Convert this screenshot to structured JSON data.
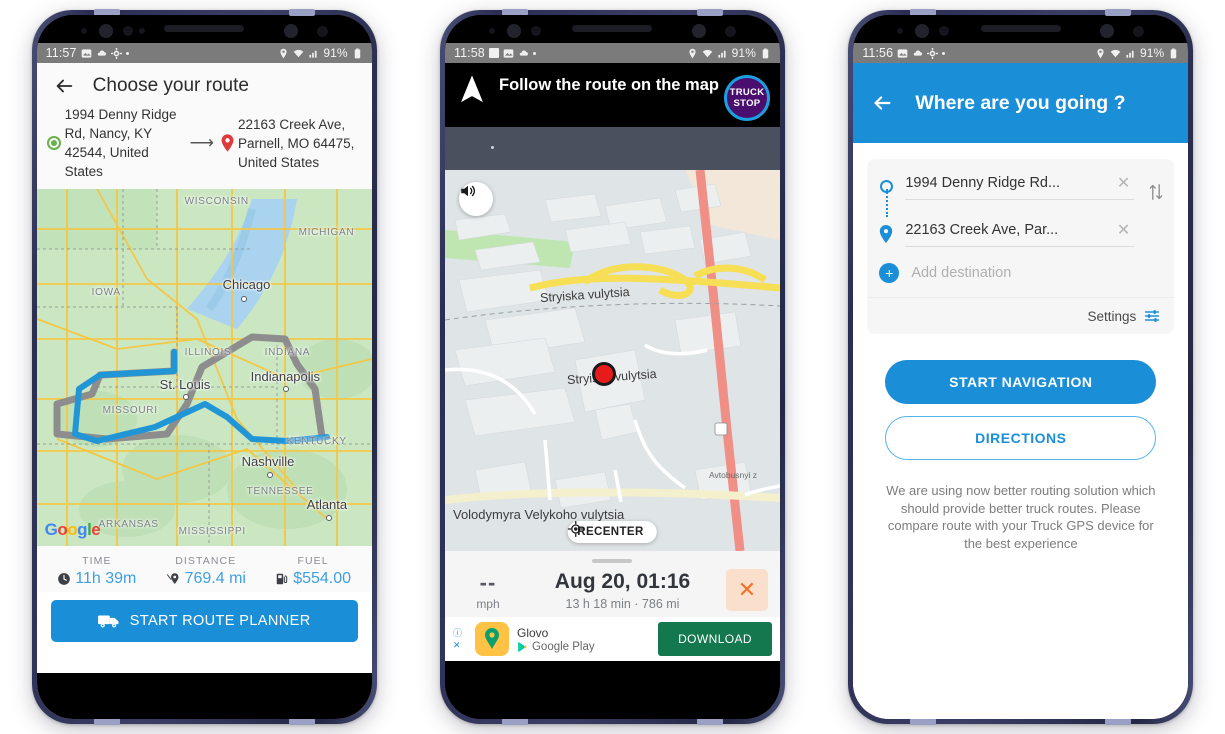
{
  "phones": [
    {
      "id": "choose-route",
      "status": {
        "time": "11:57",
        "battery": "91%",
        "icons": [
          "image-icon",
          "cloud-icon",
          "gear-icon",
          "dot-icon"
        ],
        "right_icons": [
          "location-pin-icon",
          "wifi-icon",
          "signal-icon",
          "battery-icon"
        ]
      },
      "header": {
        "title": "Choose your route",
        "back_icon": "back-arrow-icon"
      },
      "origin": "1994 Denny Ridge Rd, Nancy, KY 42544, United States",
      "destination": "22163 Creek Ave, Parnell, MO 64475, United States",
      "map": {
        "attribution": "Google",
        "state_labels": [
          "WISCONSIN",
          "MICHIGAN",
          "IOWA",
          "ILLINOIS",
          "INDIANA",
          "MISSOURI",
          "KENTUCKY",
          "TENNESSEE",
          "ARKANSAS",
          "MISSISSIPPI"
        ],
        "city_labels": [
          "Chicago",
          "Indianapolis",
          "St. Louis",
          "Nashville",
          "Atlanta"
        ],
        "route_colors": {
          "selected": "#2196d6",
          "alternate": "#8a8a8a"
        }
      },
      "stats": [
        {
          "label": "TIME",
          "value": "11h 39m",
          "icon": "clock-icon"
        },
        {
          "label": "DISTANCE",
          "value": "769.4 mi",
          "icon": "route-pin-icon"
        },
        {
          "label": "FUEL",
          "value": "$554.00",
          "icon": "fuel-pump-icon"
        }
      ],
      "cta": {
        "label": "START ROUTE PLANNER",
        "icon": "truck-icon",
        "color": "#1a8fd8"
      }
    },
    {
      "id": "navigation",
      "status": {
        "time": "11:58",
        "battery": "91%"
      },
      "banner": {
        "text": "Follow the route on the map",
        "nav_icon": "navigation-arrow-icon",
        "badge_line1": "TRUCK",
        "badge_line2": "STOP"
      },
      "map": {
        "street_labels": [
          "Stryiska  vulytsia",
          "Stryiska  vulytsia",
          "Volodymyra  Velykoho  vulytsia",
          "Avtobusnyi z"
        ],
        "sound_icon": "speaker-icon",
        "recenter_label": "RECENTER",
        "recenter_icon": "crosshair-icon",
        "position_marker": "red-dot-marker"
      },
      "bottom": {
        "speed_value": "--",
        "speed_unit": "mph",
        "eta": "Aug 20, 01:16",
        "eta_sub": "13 h 18 min  ·  786 mi",
        "close_icon": "close-icon"
      },
      "ad": {
        "title": "Glovo",
        "store": "Google Play",
        "button": "DOWNLOAD",
        "info_icon": "info-icon",
        "close_icon": "ad-close-icon",
        "button_color": "#14784f"
      }
    },
    {
      "id": "where-are-you-going",
      "status": {
        "time": "11:56",
        "battery": "91%"
      },
      "header": {
        "title": "Where are you going ?",
        "back_icon": "back-arrow-icon",
        "color": "#1a8fd8"
      },
      "origin_value": "1994 Denny Ridge Rd...",
      "destination_value": "22163 Creek Ave, Par...",
      "add_destination_placeholder": "Add destination",
      "settings_label": "Settings",
      "settings_icon": "sliders-icon",
      "swap_icon": "swap-vertical-icon",
      "clear_icon": "close-icon",
      "primary_button": "START NAVIGATION",
      "secondary_button": "DIRECTIONS",
      "note": "We are using now better routing solution which should provide better truck routes. Please compare route with your Truck GPS device for the best experience"
    }
  ]
}
